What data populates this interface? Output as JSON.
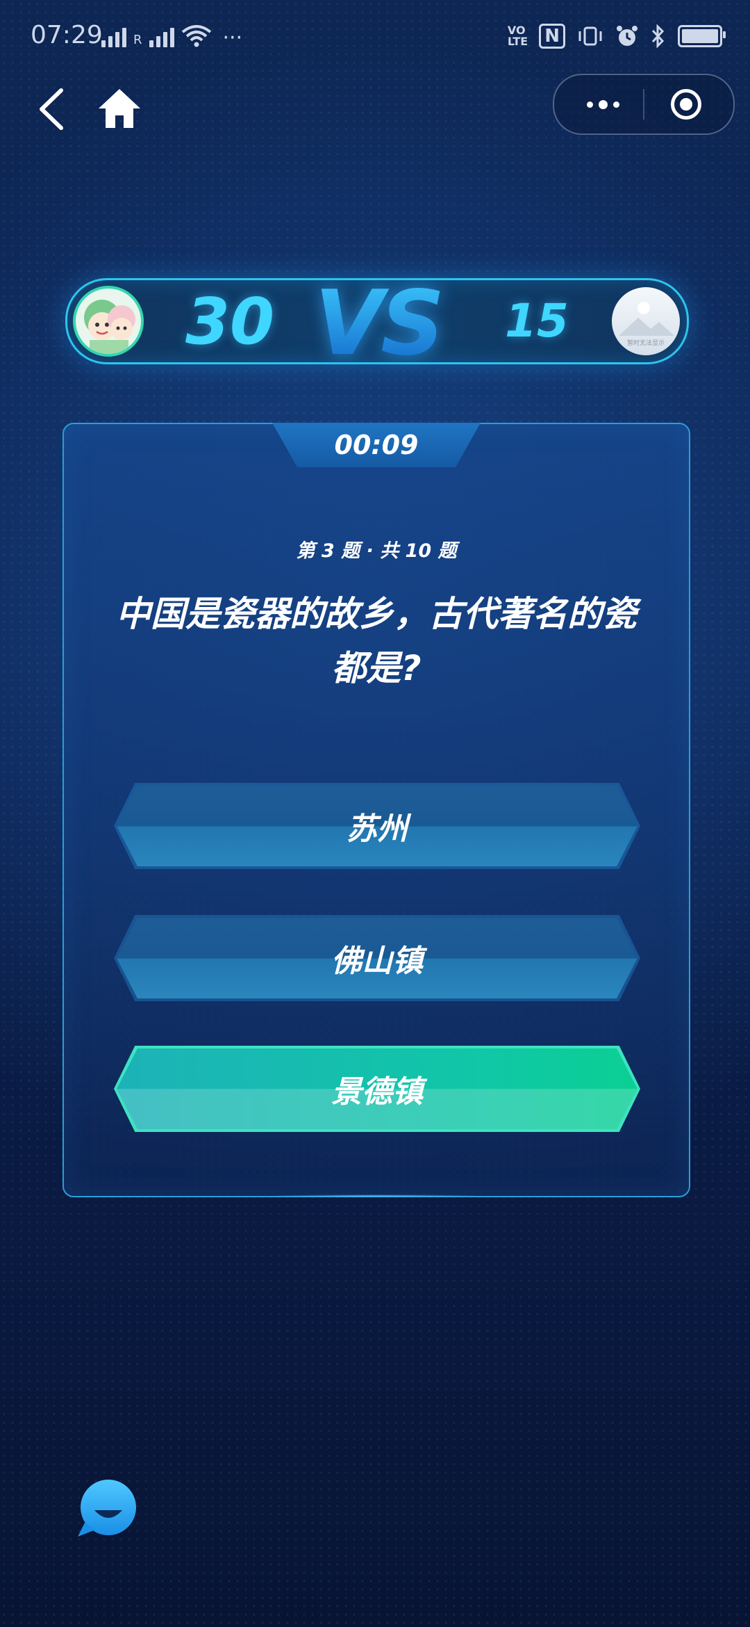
{
  "status_bar": {
    "time": "07:29",
    "carrier_letter": "R",
    "more": "···",
    "volte": "VO\nLTE",
    "nfc": "N"
  },
  "nav": {
    "back_icon": "chevron-left-icon",
    "home_icon": "home-icon"
  },
  "battle": {
    "my_score": "30",
    "vs": "VS",
    "opponent_score": "15",
    "opponent_avatar_caption": "暂时无法显示"
  },
  "question": {
    "timer": "00:09",
    "progress": "第 3 题 · 共 10 题",
    "text": "中国是瓷器的故乡，古代著名的瓷都是?",
    "options": [
      {
        "label": "苏州",
        "state": "normal"
      },
      {
        "label": "佛山镇",
        "state": "normal"
      },
      {
        "label": "景德镇",
        "state": "correct"
      }
    ]
  },
  "colors": {
    "accent": "#3fd6ff",
    "correct": "#10c7a6",
    "panel_border": "#2b9ed6"
  }
}
